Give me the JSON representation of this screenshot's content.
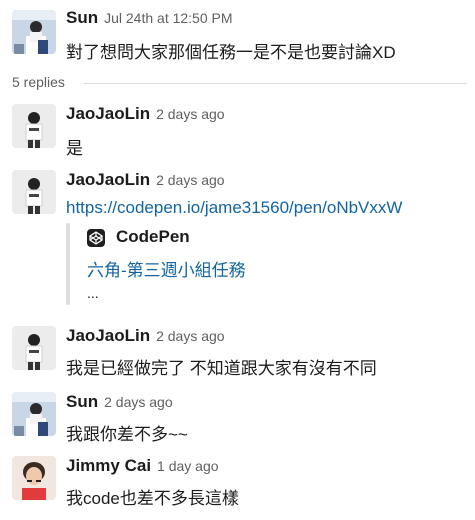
{
  "parent": {
    "author": "Sun",
    "time": "Jul 24th at 12:50 PM",
    "text": "對了想問大家那個任務一是不是也要討論XD",
    "avatar_icon": "user-photo-sun"
  },
  "thread": {
    "replies_label": "5 replies"
  },
  "replies": [
    {
      "author": "JaoJaoLin",
      "time": "2 days ago",
      "text": "是",
      "avatar_icon": "user-photo-jaojaolin"
    },
    {
      "author": "JaoJaoLin",
      "time": "2 days ago",
      "link": "https://codepen.io/jame31560/pen/oNbVxxW",
      "avatar_icon": "user-photo-jaojaolin"
    },
    {
      "author": "JaoJaoLin",
      "time": "2 days ago",
      "text": "我是已經做完了 不知道跟大家有沒有不同",
      "avatar_icon": "user-photo-jaojaolin"
    },
    {
      "author": "Sun",
      "time": "2 days ago",
      "text": "我跟你差不多~~",
      "avatar_icon": "user-photo-sun"
    },
    {
      "author": "Jimmy Cai",
      "time": "1 day ago",
      "text": "我code也差不多長這樣",
      "avatar_icon": "user-photo-jimmy-cai"
    }
  ],
  "unfurl": {
    "site_name": "CodePen",
    "site_icon": "codepen-icon",
    "title": "六角-第三週小組任務",
    "description": "..."
  },
  "colors": {
    "link": "#1264a3",
    "text": "#1d1c1d",
    "muted": "#616061",
    "divider": "#dddddd"
  }
}
